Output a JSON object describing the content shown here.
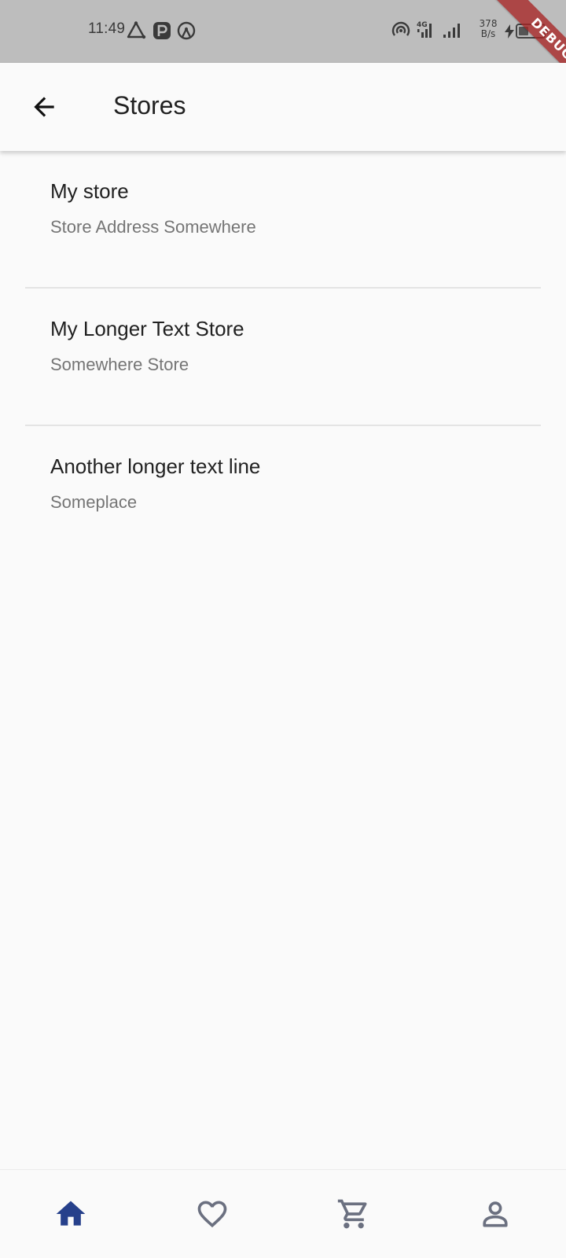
{
  "status_bar": {
    "time": "11:49",
    "net_speed_value": "378",
    "net_speed_unit": "B/s",
    "battery_level": 0.4,
    "icons": [
      "triangle-icon",
      "parking-icon",
      "hotspot-icon",
      "wifi-call-icon",
      "4g-signal-icon",
      "signal-icon",
      "charging-icon",
      "battery-icon"
    ]
  },
  "debug_banner": "DEBUG",
  "app_bar": {
    "back_icon": "arrow-back-icon",
    "title": "Stores"
  },
  "stores": [
    {
      "name": "My store",
      "address": "Store Address Somewhere"
    },
    {
      "name": "My Longer Text Store",
      "address": "Somewhere Store"
    },
    {
      "name": "Another longer text line",
      "address": "Someplace"
    }
  ],
  "bottom_nav": {
    "items": [
      {
        "icon": "home-icon",
        "active": true
      },
      {
        "icon": "favorite-icon",
        "active": false
      },
      {
        "icon": "cart-icon",
        "active": false
      },
      {
        "icon": "profile-icon",
        "active": false
      }
    ]
  },
  "colors": {
    "status_bar_bg": "#bdbdbd",
    "background": "#fafafa",
    "active_nav": "#26408b",
    "inactive_nav": "#6b7080",
    "subtitle": "#757575",
    "debug_ribbon": "#a62424"
  }
}
